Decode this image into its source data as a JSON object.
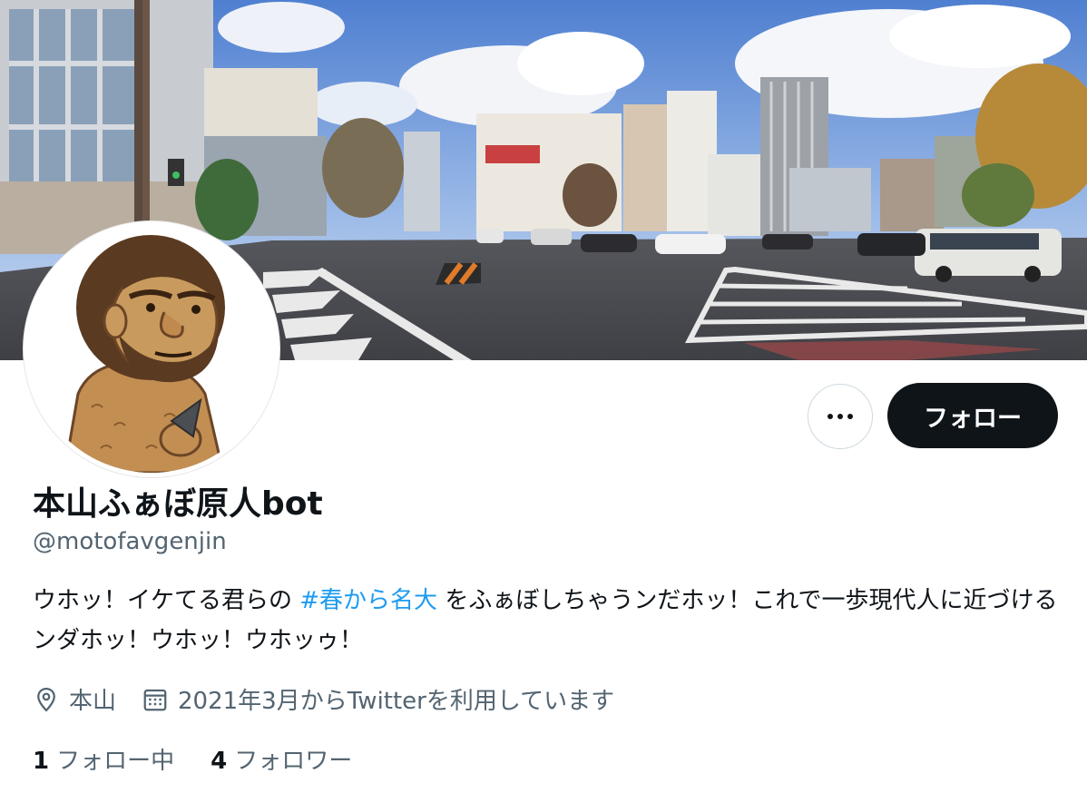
{
  "profile": {
    "display_name": "本山ふぁぼ原人bot",
    "handle": "@motofavgenjin",
    "bio_part1": "ウホッ！イケてる君らの ",
    "bio_hashtag": "#春から名大",
    "bio_part2": " をふぁぼしちゃうンだホッ！これで一歩現代人に近づけるンダホッ！ウホッ！ウホッゥ！",
    "location": "本山",
    "joined": "2021年3月からTwitterを利用しています",
    "following_count": "1",
    "following_label": "フォロー中",
    "followers_count": "4",
    "followers_label": "フォロワー"
  },
  "actions": {
    "follow_label": "フォロー",
    "more_icon": "more-horizontal-icon"
  },
  "colors": {
    "accent": "#1d9bf0",
    "text": "#0f1419",
    "secondary": "#536471",
    "follow_button": "#0f1419"
  },
  "icons": {
    "location": "location-pin-icon",
    "joined": "calendar-icon"
  }
}
